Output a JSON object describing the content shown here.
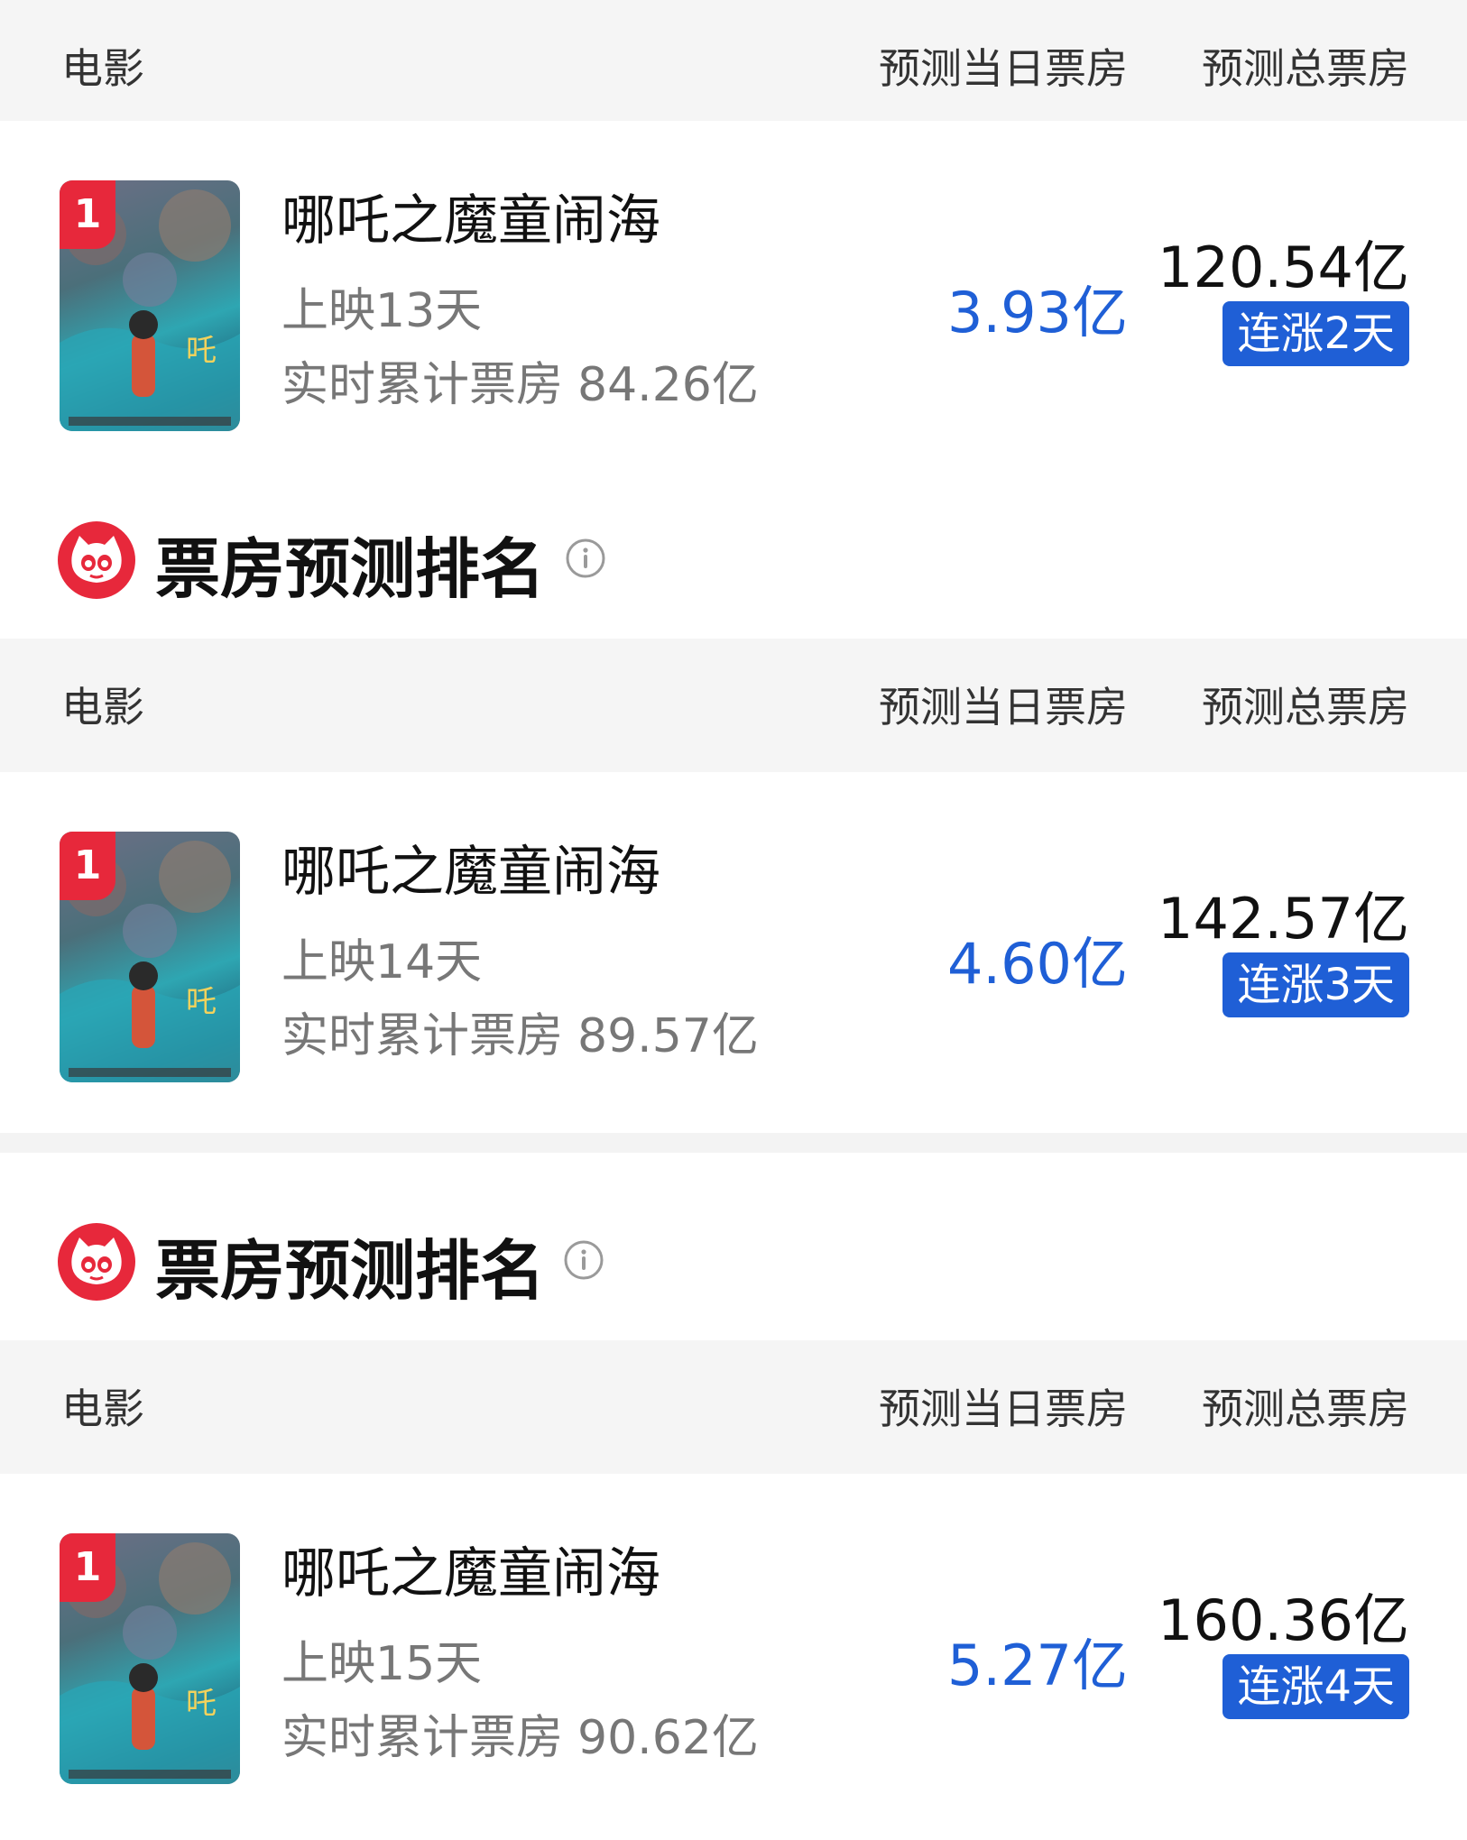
{
  "columns": {
    "movie": "电影",
    "daily": "预测当日票房",
    "total": "预测总票房"
  },
  "section_title": "票房预测排名",
  "sections": [
    {
      "rank": "1",
      "title": "哪吒之魔童闹海",
      "days": "上映13天",
      "realtime_label": "实时累计票房",
      "realtime_value": "84.26亿",
      "daily_value": "3.93亿",
      "total_value": "120.54亿",
      "streak": "连涨2天"
    },
    {
      "rank": "1",
      "title": "哪吒之魔童闹海",
      "days": "上映14天",
      "realtime_label": "实时累计票房",
      "realtime_value": "89.57亿",
      "daily_value": "4.60亿",
      "total_value": "142.57亿",
      "streak": "连涨3天"
    },
    {
      "rank": "1",
      "title": "哪吒之魔童闹海",
      "days": "上映15天",
      "realtime_label": "实时累计票房",
      "realtime_value": "90.62亿",
      "daily_value": "5.27亿",
      "total_value": "160.36亿",
      "streak": "连涨4天"
    }
  ],
  "colors": {
    "accent_blue": "#1f5fd6",
    "rank_red": "#e7283b",
    "header_bg": "#f5f5f5",
    "logo_red": "#e7283b"
  },
  "icons": {
    "logo": "maoyan-cat-icon",
    "info": "info-icon"
  }
}
